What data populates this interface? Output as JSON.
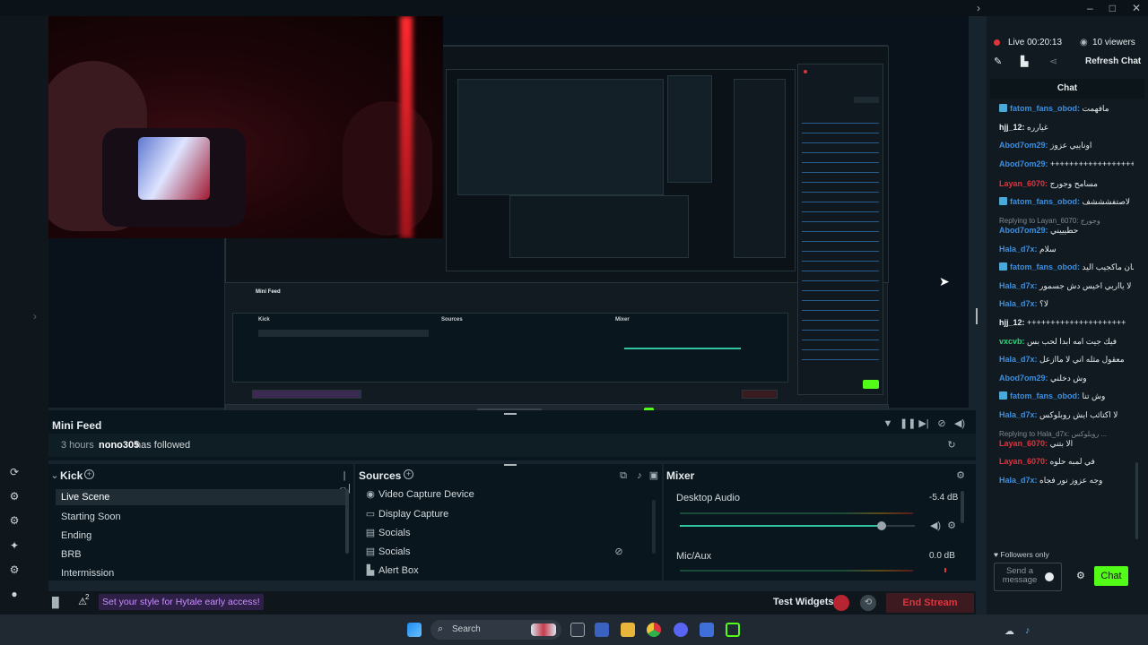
{
  "app": {
    "window_controls": [
      "–",
      "□",
      "✕"
    ]
  },
  "status": {
    "live_time": "Live 00:20:13",
    "viewers": "10 viewers",
    "refresh_chat": "Refresh Chat"
  },
  "chat": {
    "title": "Chat",
    "messages": [
      {
        "user": "fatom_fans_obod:",
        "text": "مافهمت",
        "color": "#3d8fe0",
        "platform": true
      },
      {
        "user": "hjj_12:",
        "text": "غيارره",
        "color": "#e8edef",
        "platform": false
      },
      {
        "user": "Abod7om29:",
        "text": "اوناييي عزوز",
        "color": "#3d8fe0",
        "platform": false
      },
      {
        "user": "Abod7om29:",
        "text": "++++++++++++++++++++++++++++++++++++++++++",
        "color": "#3d8fe0",
        "platform": false
      },
      {
        "user": "Layan_6070:",
        "text": "مسامح وجورج",
        "color": "#e0343f",
        "platform": false
      },
      {
        "user": "fatom_fans_obod:",
        "text": "لاصتفشششف",
        "color": "#3d8fe0",
        "platform": true
      },
      {
        "user": "Abod7om29:",
        "text": "حطيييني",
        "color": "#3d8fe0",
        "platform": false,
        "reply": "Replying to Layan_6070: وجورج"
      },
      {
        "user": "Hala_d7x:",
        "text": "سلام",
        "color": "#3d8fe0",
        "platform": false
      },
      {
        "user": "fatom_fans_obod:",
        "text": "عشان ماكجيب اليد",
        "color": "#3d8fe0",
        "platform": true
      },
      {
        "user": "Hala_d7x:",
        "text": "لا يااربي اخيس دش جسمور",
        "color": "#3d8fe0",
        "platform": false
      },
      {
        "user": "Hala_d7x:",
        "text": "لا؟",
        "color": "#3d8fe0",
        "platform": false
      },
      {
        "user": "hjj_12:",
        "text": "+++++++++++++++++++++",
        "color": "#e8edef",
        "platform": false
      },
      {
        "user": "vxcvb:",
        "text": "فيك جيت امه ابدا لحب بس",
        "color": "#2fd17a",
        "platform": false
      },
      {
        "user": "Hala_d7x:",
        "text": "معقول مثله اني لا ماازعل",
        "color": "#3d8fe0",
        "platform": false
      },
      {
        "user": "Abod7om29:",
        "text": "وش دخلني",
        "color": "#3d8fe0",
        "platform": false
      },
      {
        "user": "fatom_fans_obod:",
        "text": "وش تنا",
        "color": "#3d8fe0",
        "platform": true
      },
      {
        "user": "Hala_d7x:",
        "text": "لا اكتائب ايش روبلوكس",
        "color": "#3d8fe0",
        "platform": false
      },
      {
        "user": "Layan_6070:",
        "text": "الا بتني",
        "color": "#e0343f",
        "platform": false,
        "reply": "Replying to Hala_d7x: روبلوكس ..."
      },
      {
        "user": "Layan_6070:",
        "text": "في لمبه حلوه",
        "color": "#e0343f",
        "platform": false
      },
      {
        "user": "Hala_d7x:",
        "text": "وجه عزوز نور فجاه",
        "color": "#3d8fe0",
        "platform": false
      }
    ],
    "followers_only": "Followers only",
    "send_placeholder": "Send a message",
    "chat_button": "Chat"
  },
  "mini_feed": {
    "title": "Mini Feed",
    "entry_time": "3 hours",
    "entry_user": "nono305",
    "entry_text": "has followed"
  },
  "scenes": {
    "title": "Kick",
    "items": [
      "Live Scene",
      "Starting Soon",
      "Ending",
      "BRB",
      "Intermission"
    ],
    "selected": "Live Scene"
  },
  "sources": {
    "title": "Sources",
    "items": [
      "Video Capture Device",
      "Display Capture",
      "Socials",
      "Socials",
      "Alert Box"
    ]
  },
  "mixer": {
    "title": "Mixer",
    "channels": [
      {
        "name": "Desktop Audio",
        "db": "-5.4 dB",
        "level": 0.86
      },
      {
        "name": "Mic/Aux",
        "db": "0.0 dB",
        "level": 1.0
      }
    ]
  },
  "statusbar": {
    "promo": "Set your style for Hytale early access!",
    "notif_count": "2",
    "test_widgets": "Test Widgets",
    "end_stream": "End Stream"
  },
  "taskbar": {
    "search_placeholder": "Search"
  },
  "colors": {
    "accent_green": "#53fc18",
    "end_stream_red": "#e0343f",
    "username_blue": "#3d8fe0",
    "slider_teal": "#31c3a2",
    "promo_purple": "#c891ff"
  }
}
